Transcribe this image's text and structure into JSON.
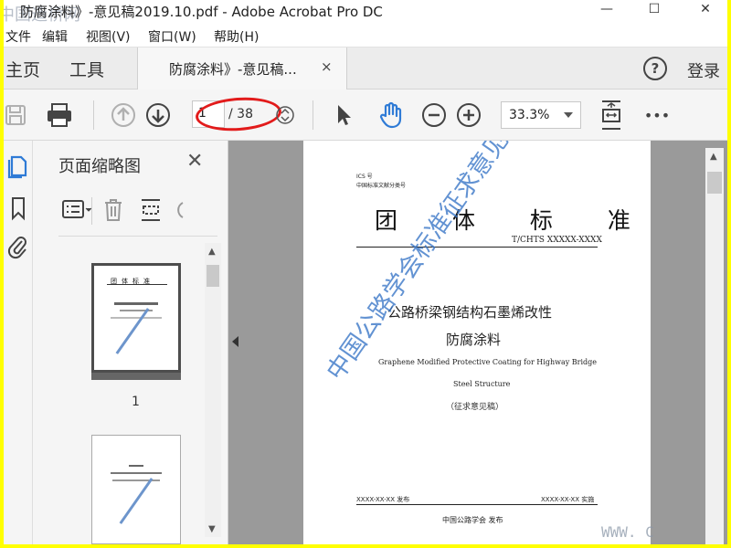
{
  "window": {
    "title": "防腐涂料》-意见稿2019.10.pdf - Adobe Acrobat Pro DC",
    "corner_watermark": "中国造桥网",
    "minimize": "—",
    "maximize": "☐",
    "close": "✕"
  },
  "menu": {
    "items": [
      "文件",
      "编辑",
      "视图(V)",
      "窗口(W)",
      "帮助(H)"
    ]
  },
  "tabs": {
    "home": "主页",
    "tools": "工具",
    "document": "防腐涂料》-意见稿...",
    "close_tab": "×",
    "help": "?",
    "login": "登录"
  },
  "toolbar": {
    "current_page": "1",
    "total_pages": "/ 38",
    "zoom": "33.3%",
    "more": "•••"
  },
  "thumbnails": {
    "title": "页面缩略图",
    "close": "✕",
    "page_label": "1"
  },
  "pdf_page": {
    "ics": "ICS 号",
    "classification": "中国标准文献分类号",
    "heading": "团 体 标 准",
    "code": "T/CHTS XXXXX-XXXX",
    "title_cn_line1": "公路桥梁钢结构石墨烯改性",
    "title_cn_line2": "防腐涂料",
    "title_en_line1": "Graphene Modified Protective Coating for Highway Bridge",
    "title_en_line2": "Steel Structure",
    "draft_label": "（征求意见稿）",
    "release_date": "XXXX-XX-XX 发布",
    "implement_date": "XXXX-XX-XX 实施",
    "publisher": "中国公路学会  发布",
    "stamp": "中国公路学会标准征求意见稿"
  },
  "site_watermark": "WWW. C",
  "colors": {
    "accent_blue": "#2f7bd6",
    "annotation_red": "#e21b1b",
    "stamp_blue": "#3b78c8",
    "frame_yellow": "#ffff00"
  }
}
